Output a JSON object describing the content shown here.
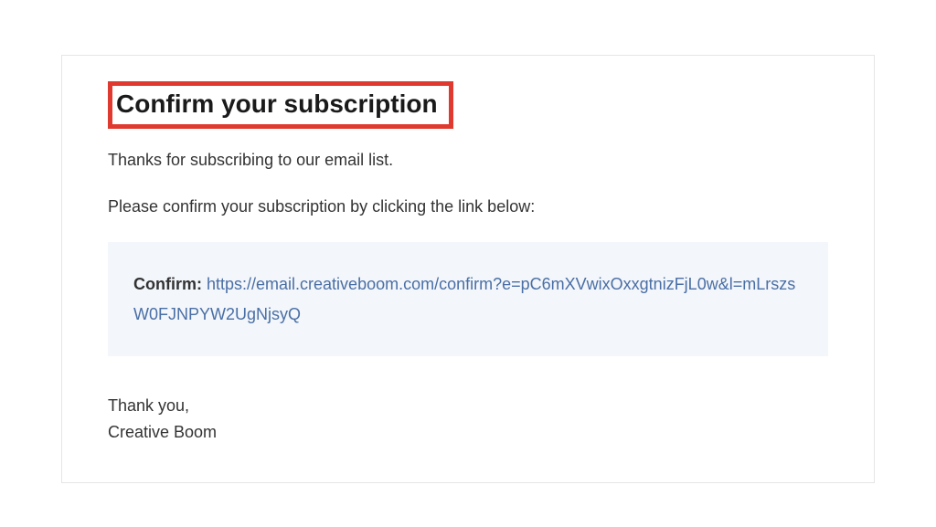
{
  "email": {
    "heading": "Confirm your subscription",
    "intro": "Thanks for subscribing to our email list.",
    "instruction": "Please confirm your subscription by clicking the link below:",
    "linkLabel": "Confirm: ",
    "linkUrl": "https://email.creativeboom.com/confirm?e=pC6mXVwixOxxgtnizFjL0w&l=mLrszsW0FJNPYW2UgNjsyQ",
    "thanks": "Thank you,",
    "sender": "Creative Boom"
  }
}
